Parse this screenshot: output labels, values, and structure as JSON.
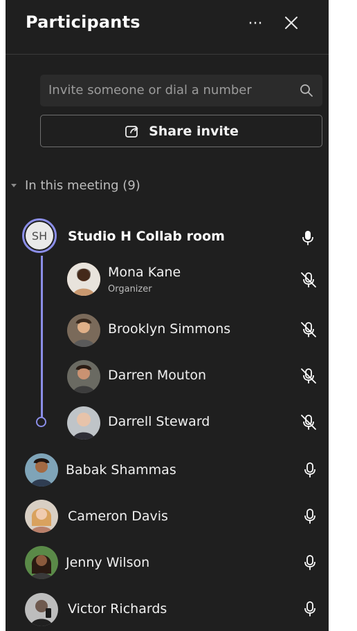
{
  "header": {
    "title": "Participants",
    "more_icon": "more-horizontal-icon",
    "close_icon": "close-icon"
  },
  "search": {
    "placeholder": "Invite someone or dial a number",
    "icon": "search-icon"
  },
  "share": {
    "label": "Share invite",
    "icon": "share-icon"
  },
  "section": {
    "label": "In this meeting (9)",
    "expanded": true
  },
  "room": {
    "initials": "SH",
    "name": "Studio H Collab room",
    "mic": "mic-on"
  },
  "room_members": [
    {
      "name": "Mona Kane",
      "role": "Organizer",
      "mic": "mic-off",
      "avatar_color": "#d9a07a"
    },
    {
      "name": "Brooklyn Simmons",
      "role": "",
      "mic": "mic-off",
      "avatar_color": "#c59b72"
    },
    {
      "name": "Darren Mouton",
      "role": "",
      "mic": "mic-off",
      "avatar_color": "#b07a5a"
    },
    {
      "name": "Darrell Steward",
      "role": "",
      "mic": "mic-off",
      "avatar_color": "#d4b49c"
    }
  ],
  "participants": [
    {
      "name": "Babak Shammas",
      "mic": "mic-on",
      "avatar_color": "#a36a43"
    },
    {
      "name": "Cameron Davis",
      "mic": "mic-on",
      "avatar_color": "#e0b07b"
    },
    {
      "name": "Jenny Wilson",
      "mic": "mic-on",
      "avatar_color": "#8b5a3c"
    },
    {
      "name": "Victor Richards",
      "mic": "mic-on",
      "avatar_color": "#6f5a4f"
    }
  ],
  "colors": {
    "panel": "#1f1f1f",
    "accent": "#8b8ee8"
  }
}
